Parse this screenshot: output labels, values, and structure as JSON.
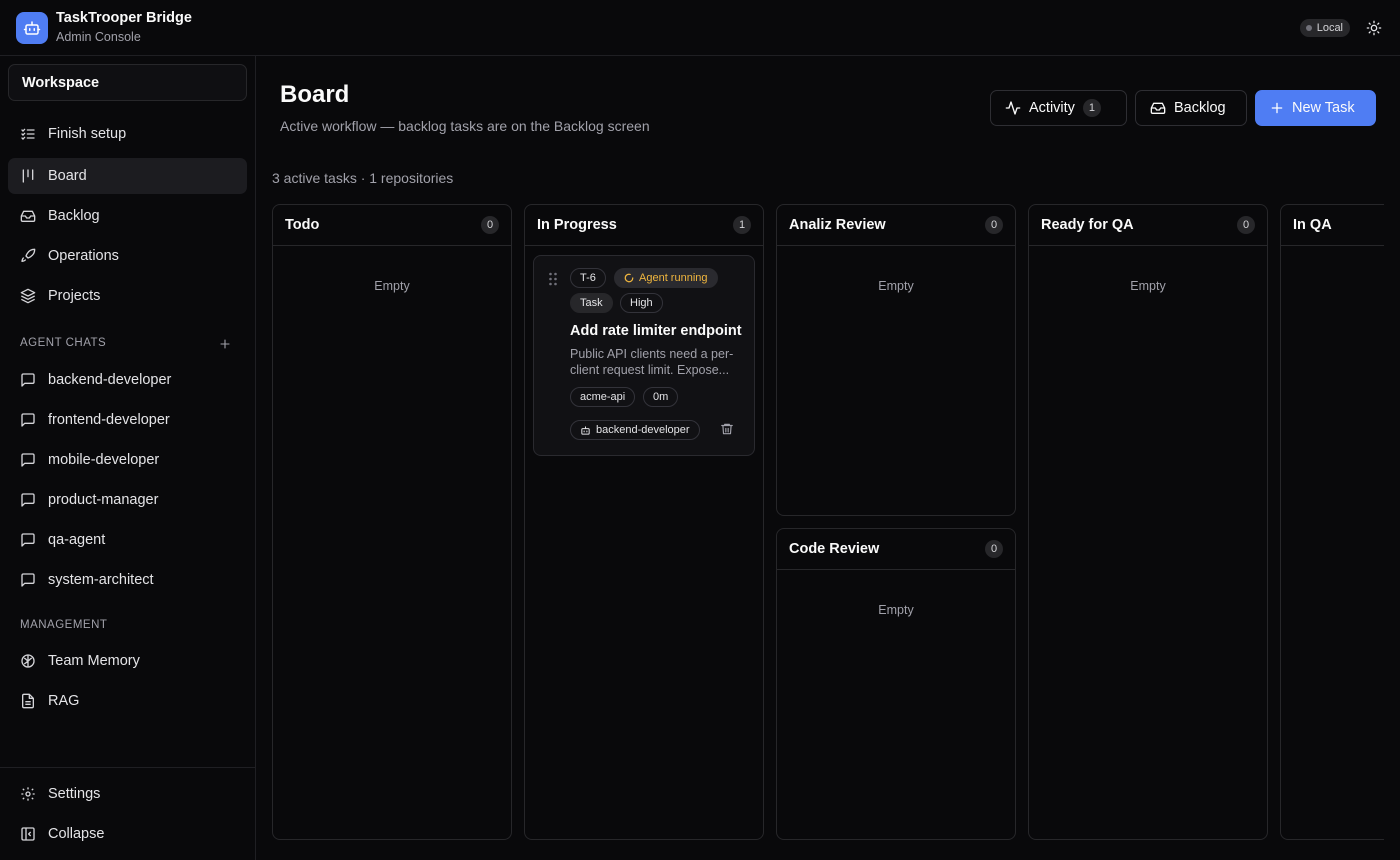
{
  "app": {
    "title": "TaskTrooper Bridge",
    "subtitle": "Admin Console",
    "env_badge": "Local"
  },
  "sidebar": {
    "workspace": "Workspace",
    "nav": [
      {
        "label": "Finish setup",
        "icon": "checklist-icon"
      },
      {
        "label": "Board",
        "icon": "kanban-icon",
        "active": true
      },
      {
        "label": "Backlog",
        "icon": "inbox-icon"
      },
      {
        "label": "Operations",
        "icon": "rocket-icon"
      },
      {
        "label": "Projects",
        "icon": "layers-icon"
      }
    ],
    "agent_chats_label": "AGENT CHATS",
    "agent_chats": [
      "backend-developer",
      "frontend-developer",
      "mobile-developer",
      "product-manager",
      "qa-agent",
      "system-architect"
    ],
    "management_label": "MANAGEMENT",
    "management": [
      {
        "label": "Team Memory",
        "icon": "brain-icon"
      },
      {
        "label": "RAG",
        "icon": "document-icon"
      }
    ],
    "footer": {
      "settings": "Settings",
      "collapse": "Collapse"
    }
  },
  "main": {
    "title": "Board",
    "subtitle": "Active workflow — backlog tasks are on the Backlog screen",
    "buttons": {
      "activity": "Activity",
      "activity_count": "1",
      "backlog": "Backlog",
      "new_task": "New Task"
    },
    "summary": "3 active tasks · 1 repositories"
  },
  "board": {
    "empty_label": "Empty",
    "columns": [
      {
        "title": "Todo",
        "count": "0"
      },
      {
        "title": "In Progress",
        "count": "1"
      },
      {
        "title": "Analiz Review",
        "count": "0"
      },
      {
        "title": "Code Review",
        "count": "0"
      },
      {
        "title": "Ready for QA",
        "count": "0"
      },
      {
        "title": "In QA",
        "count": ""
      }
    ],
    "card": {
      "id": "T-6",
      "status": "Agent running",
      "type": "Task",
      "priority": "High",
      "title": "Add rate limiter endpoint",
      "description": "Public API clients need a per-client request limit. Expose...",
      "repo": "acme-api",
      "duration": "0m",
      "agent": "backend-developer"
    }
  },
  "colors": {
    "accent": "#4f7df3",
    "running": "#f0b63e",
    "background": "#09090b"
  }
}
